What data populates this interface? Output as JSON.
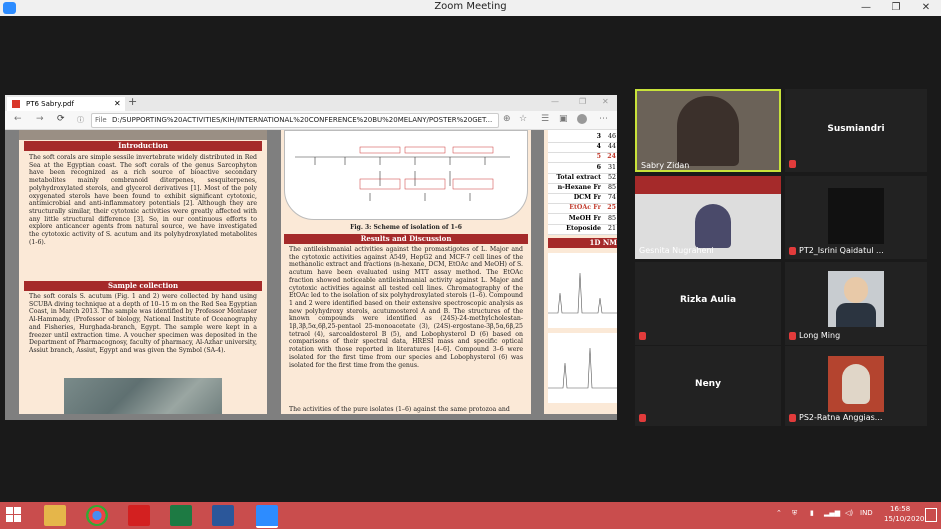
{
  "zoom": {
    "title": "Zoom Meeting",
    "min": "—",
    "restore": "❐",
    "close": "✕"
  },
  "browser": {
    "tab_label": "PT6 Sabry.pdf",
    "tab_close": "✕",
    "new_tab": "+",
    "file_label": "File",
    "address": "D:/SUPPORTING%20ACTIVITIES/KIH/INTERNATIONAL%20CONFERENCE%20BU%20MELANY/POSTER%20GET...",
    "win_min": "—",
    "win_max": "❐",
    "win_close": "✕"
  },
  "pdf": {
    "page1": {
      "intro_head": "Introduction",
      "intro_text": "The soft corals are simple sessile invertebrate widely distributed in Red Sea at the Egyptian coast. The soft corals of the genus Sarcophyton have been recognized as a rich source of bioactive secondary metabolites mainly cembranoid diterpenes, sesquiterpenes, polyhydroxylated sterols, and glycerol derivatives [1]. Most of the poly oxygenated sterols have been found to exhibit significant cytotoxic, antimicrobial and anti-inflammatory potentials [2]. Although they are structurally similar, their cytotoxic activities were greatly affected with any little structural difference [3]. So, in our continuous efforts to explore anticancer agents from natural source, we have investigated the cytotoxic activity of S. acutum and its polyhydroxylated metabolites (1-6).",
      "sample_head": "Sample collection",
      "sample_text": "The soft corals S. acutum (Fig. 1 and 2) were collected by hand using SCUBA diving technique at a depth of 10–15 m on the Red Sea Egyptian Coast, in March 2013. The sample was identified by Professor Montaser Al-Hammady, (Professor of biology, National Institute of Oceanography and Fisheries, Hurghada-branch, Egypt. The sample were kept in a freezer until extraction time. A voucher specimen was deposited in the Department of Pharmacognosy, faculty of pharmacy, Al-Azhar university, Assiut branch, Assiut, Egypt and was given the Symbol (SA-4)."
    },
    "page2": {
      "scheme_caption": "Fig. 3: Scheme of isolation of 1–6",
      "results_head": "Results and Discussion",
      "results_text": "The antileishmanial activities against the promastigotes of L. Major and the cytotoxic activities against A549, HepG2 and MCF-7 cell lines of the methanolic extract and fractions (n-hexane, DCM, EtOAc and MeOH) of S. acutum have been evaluated using MTT assay method. The EtOAc fraction showed noticeable antileishmanial activity against L. Major and cytotoxic activities against all tested cell lines. Chromatography of the EtOAc led to the isolation of six polyhydroxylated sterols (1–6). Compound 1 and 2 were identified based on their extensive spectroscopic analysis as new polyhydroxy sterols, acutumosterol A and B. The structures of the known compounds were identified as (24S)-24-methylcholestan-1β,3β,5α,6β,25-pentaol 25-monoacetate (3), (24S)-ergostane-3β,5α,6β,25 tetraol (4), sarcoaldosterol B (5), and Lobophysterol D (6) based on comparisons of their spectral data, HRESI mass and specific optical rotation with those reported in literatures [4–6]. Compound 3–6 were isolated for the first time from our species and Lobophysterol (6) was isolated for the first time from the genus.",
      "results_tail": "The activities of the pure isolates (1–6) against the same protozoa and"
    },
    "page3": {
      "rows": [
        {
          "label": "3",
          "value": "46"
        },
        {
          "label": "4",
          "value": "44"
        },
        {
          "label": "5",
          "value": "24"
        },
        {
          "label": "6",
          "value": "31"
        },
        {
          "label": "Total extract",
          "value": "52"
        },
        {
          "label": "n-Hexane Fr",
          "value": "85"
        },
        {
          "label": "DCM Fr",
          "value": "74"
        },
        {
          "label": "EtOAc Fr",
          "value": "25"
        },
        {
          "label": "MeOH Fr",
          "value": "85"
        },
        {
          "label": "Etoposide",
          "value": "21"
        }
      ],
      "section_head": "1D NM"
    }
  },
  "participants": [
    {
      "name": "Sabry Zidan"
    },
    {
      "name": "Susmiandri"
    },
    {
      "name": "Gesnita Nugraheni"
    },
    {
      "name": "PT2_Isrini Qaidatul ..."
    },
    {
      "name": "Rizka Aulia"
    },
    {
      "name": "Long Ming"
    },
    {
      "name": "Neny"
    },
    {
      "name": "PS2-Ratna Anggias..."
    }
  ],
  "taskbar": {
    "lang": "IND",
    "time": "16:58",
    "date": "15/10/2020"
  },
  "colors": {
    "active_speaker": "#c8e23a",
    "poster_red": "#a52a2a",
    "taskbar": "#c94d4d"
  }
}
